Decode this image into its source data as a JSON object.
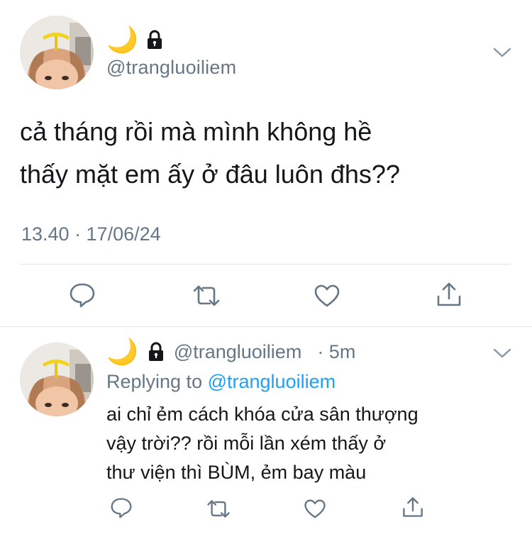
{
  "main_tweet": {
    "display_name": "🌙",
    "handle": "@trangluoiliem",
    "text_lines": [
      "cả tháng rồi mà mình không hề",
      "thấy mặt em ấy ở đâu luôn đhs??"
    ],
    "timestamp": "13.40 · 17/06/24",
    "icons": {
      "lock": "lock-icon",
      "menu": "chevron-down-icon",
      "reply": "reply-icon",
      "retweet": "retweet-icon",
      "like": "like-icon",
      "share": "share-icon"
    }
  },
  "reply_tweet": {
    "display_name": "🌙",
    "handle": "@trangluoiliem",
    "time": "· 5m",
    "replying_prefix": "Replying to",
    "replying_to": "@trangluoiliem",
    "text_lines": [
      "ai chỉ ẻm cách khóa cửa sân thượng",
      "vậy trời?? rồi mỗi lần xém thấy ở",
      "thư viện thì BÙM, ẻm bay màu"
    ]
  },
  "colors": {
    "text": "#14171a",
    "secondary": "#657786",
    "link": "#1da1f2",
    "divider": "#e1e8ed"
  }
}
